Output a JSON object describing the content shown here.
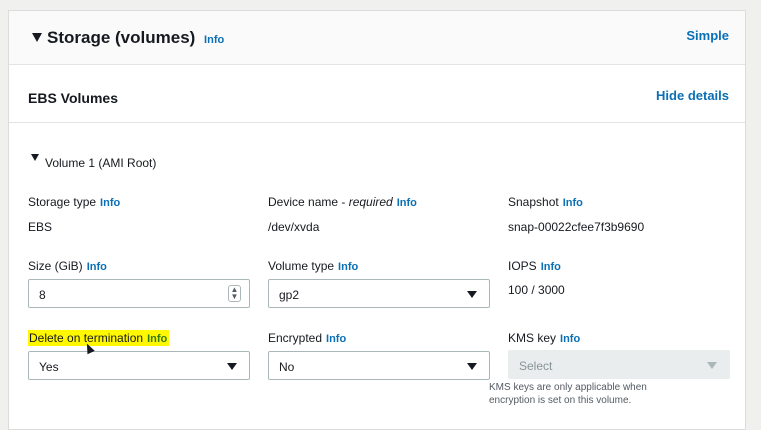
{
  "section": {
    "title": "Storage (volumes)",
    "info": "Info",
    "mode_link": "Simple"
  },
  "ebs": {
    "title": "EBS Volumes",
    "hide_link": "Hide details"
  },
  "volume": {
    "title": "Volume 1 (AMI Root)"
  },
  "fields": {
    "storage_type": {
      "label": "Storage type",
      "info": "Info",
      "value": "EBS"
    },
    "device_name": {
      "label_prefix": "Device name - ",
      "label_required": "required",
      "info": "Info",
      "value": "/dev/xvda"
    },
    "snapshot": {
      "label": "Snapshot",
      "info": "Info",
      "value": "snap-00022cfee7f3b9690"
    },
    "size": {
      "label": "Size (GiB)",
      "info": "Info",
      "value": "8"
    },
    "volume_type": {
      "label": "Volume type",
      "info": "Info",
      "value": "gp2"
    },
    "iops": {
      "label": "IOPS",
      "info": "Info",
      "value": "100 / 3000"
    },
    "delete_on_termination": {
      "label": "Delete on termination",
      "info": "Info",
      "value": "Yes"
    },
    "encrypted": {
      "label": "Encrypted",
      "info": "Info",
      "value": "No"
    },
    "kms_key": {
      "label": "KMS key",
      "info": "Info",
      "placeholder": "Select",
      "help_line1": "KMS keys are only applicable when",
      "help_line2": "encryption is set on this volume."
    }
  },
  "colors": {
    "link": "#0a6fb4",
    "highlight": "#fff800"
  }
}
